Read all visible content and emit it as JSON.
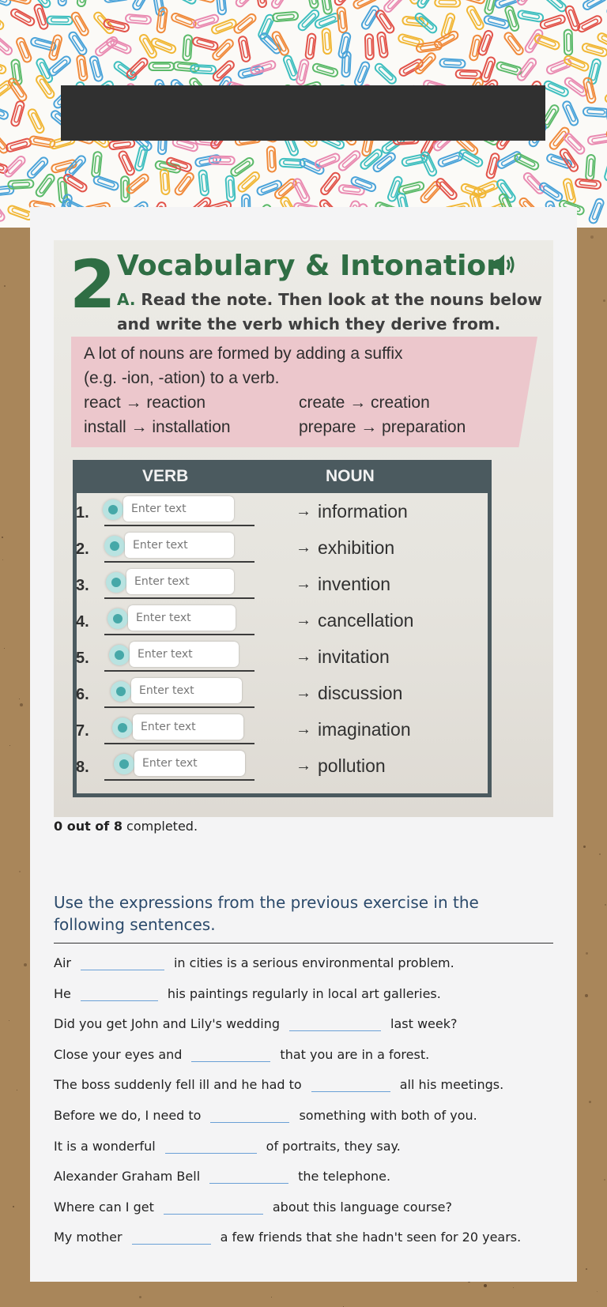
{
  "header": {
    "title": ""
  },
  "exercise1": {
    "number": "2",
    "heading": "Vocabulary & Intonation",
    "instruction_letter": "A.",
    "instruction": "Read the note. Then look at the nouns below and write the verb which they derive from.",
    "note_line1": "A lot of nouns are formed by adding a suffix",
    "note_line2": "(e.g. -ion, -ation) to a verb.",
    "examples": [
      {
        "left": "react → reaction",
        "right": "create → creation"
      },
      {
        "left": "install → installation",
        "right": "prepare → preparation"
      }
    ],
    "col_verb": "VERB",
    "col_noun": "NOUN",
    "rows": [
      {
        "num": "1.",
        "placeholder": "Enter text",
        "noun": "information"
      },
      {
        "num": "2.",
        "placeholder": "Enter text",
        "noun": "exhibition"
      },
      {
        "num": "3.",
        "placeholder": "Enter text",
        "noun": "invention"
      },
      {
        "num": "4.",
        "placeholder": "Enter text",
        "noun": "cancellation"
      },
      {
        "num": "5.",
        "placeholder": "Enter text",
        "noun": "invitation"
      },
      {
        "num": "6.",
        "placeholder": "Enter text",
        "noun": "discussion"
      },
      {
        "num": "7.",
        "placeholder": "Enter text",
        "noun": "imagination"
      },
      {
        "num": "8.",
        "placeholder": "Enter text",
        "noun": "pollution"
      }
    ],
    "arrow": "→"
  },
  "progress": {
    "count": "0 out of 8",
    "suffix": " completed."
  },
  "exercise2": {
    "title": "Use the expressions from the previous exercise in the following sentences.",
    "sentences": [
      {
        "before": "Air",
        "after": "in cities is a serious environmental problem."
      },
      {
        "before": "He",
        "after": "his paintings regularly in local art galleries."
      },
      {
        "before": "Did you get John and Lily's wedding",
        "after": "last week?"
      },
      {
        "before": "Close your eyes and",
        "after": "that you are in a forest."
      },
      {
        "before": "The boss suddenly fell ill and he had to",
        "after": "all his meetings."
      },
      {
        "before": "Before we do, I need to",
        "after": "something with both of you."
      },
      {
        "before": "It is a wonderful",
        "after": "of portraits, they say."
      },
      {
        "before": "Alexander Graham Bell",
        "after": "the telephone."
      },
      {
        "before": "Where can I get",
        "after": "about this language course?"
      },
      {
        "before": "My mother",
        "after": "a few friends that she hadn't seen for 20 years."
      }
    ]
  }
}
